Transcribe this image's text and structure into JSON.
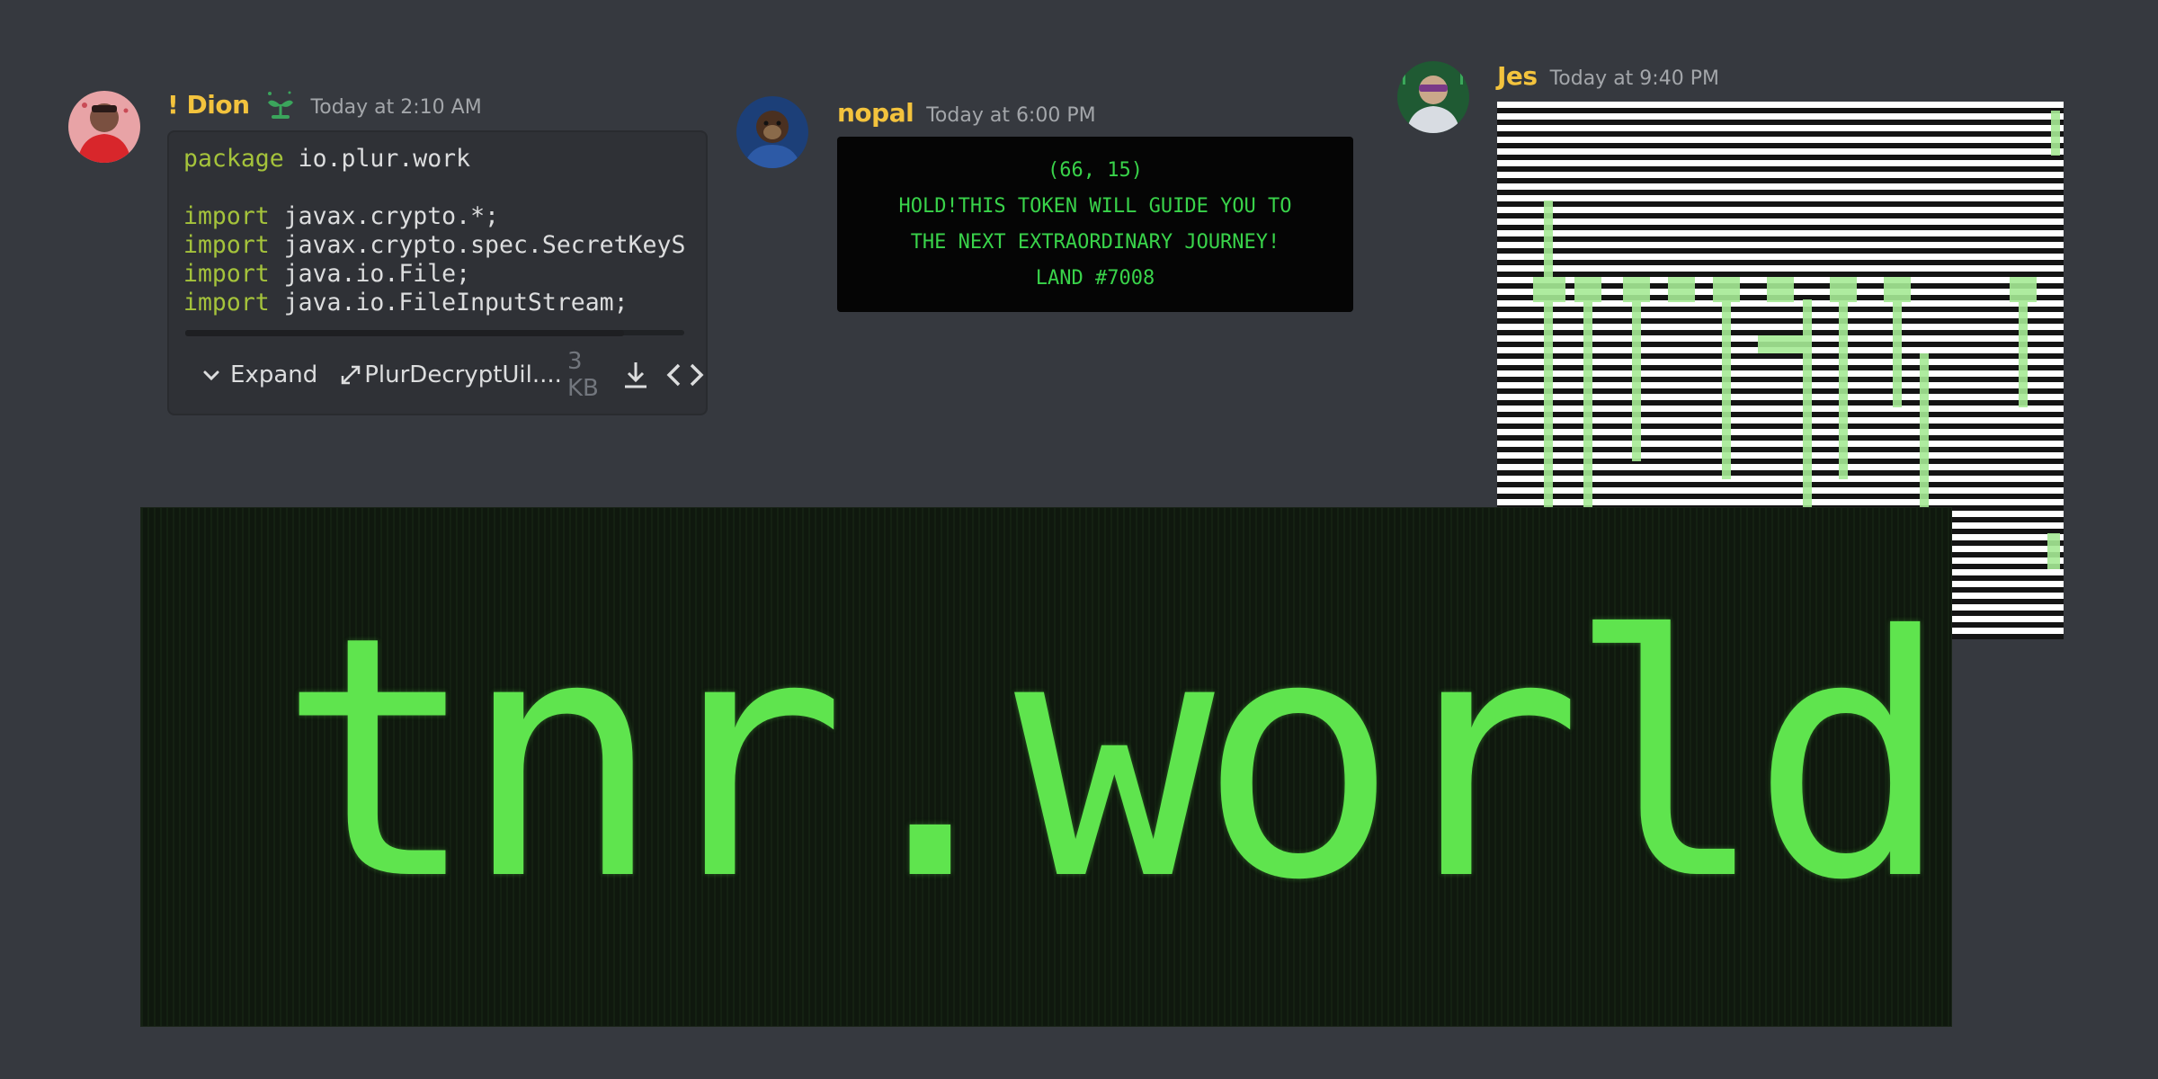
{
  "messages": {
    "dion": {
      "username": "! Dion",
      "timestamp": "Today at 2:10 AM",
      "badge_icon": "sprout-icon",
      "attachment": {
        "code_lines": [
          {
            "kw": "package",
            "text": " io.plur.work"
          },
          {
            "kw": "",
            "text": ""
          },
          {
            "kw": "import",
            "text": " javax.crypto.*;"
          },
          {
            "kw": "import",
            "text": " javax.crypto.spec.SecretKeyS"
          },
          {
            "kw": "import",
            "text": " java.io.File;"
          },
          {
            "kw": "import",
            "text": " java.io.FileInputStream;"
          }
        ],
        "expand_label": "Expand",
        "filename": "PlurDecryptUil....",
        "filesize": "3 KB"
      }
    },
    "nopal": {
      "username": "nopal",
      "timestamp": "Today at 6:00 PM",
      "token_lines": [
        "(66, 15)",
        "HOLD!THIS TOKEN WILL GUIDE YOU TO",
        "THE NEXT EXTRAORDINARY JOURNEY!",
        "LAND #7008"
      ]
    },
    "jes": {
      "username": "Jes",
      "timestamp": "Today at 9:40 PM"
    }
  },
  "banner": {
    "text": "tnr.world"
  },
  "colors": {
    "background": "#36393f",
    "username": "#f3c33d",
    "timestamp": "#a3a6aa",
    "code_keyword": "#a5c33b",
    "terminal_green": "#5fe44e"
  }
}
